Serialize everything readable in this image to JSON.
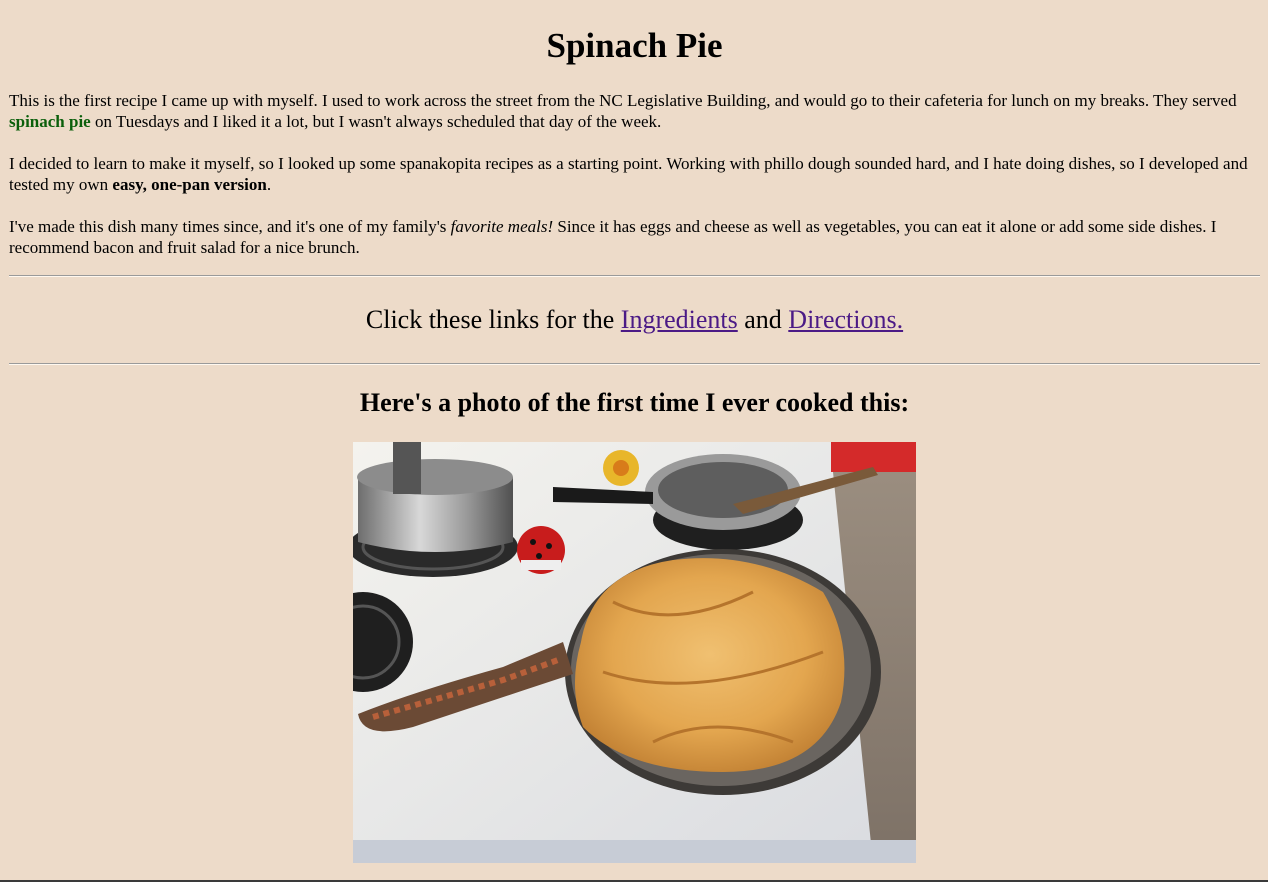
{
  "page": {
    "title": "Spinach Pie",
    "intro": {
      "p1_before": "This is the first recipe I came up with myself. I used to work across the street from the NC Legislative Building, and would go to their cafeteria for lunch on my breaks. They served ",
      "p1_emphasis": "spinach pie",
      "p1_after": " on Tuesdays and I liked it a lot, but I wasn't always scheduled that day of the week.",
      "p2_before": "I decided to learn to make it myself, so I looked up some spanakopita recipes as a starting point. Working with phillo dough sounded hard, and I hate doing dishes, so I developed and tested my own ",
      "p2_bold": "easy, one-pan version",
      "p2_after": ".",
      "p3_before": "I've made this dish many times since, and it's one of my family's ",
      "p3_italic": "favorite meals!",
      "p3_after": " Since it has eggs and cheese as well as vegetables, you can eat it alone or add some side dishes. I recommend bacon and fruit salad for a nice brunch."
    },
    "links": {
      "prefix": "Click these links for the ",
      "ingredients": "Ingredients",
      "middle": " and ",
      "directions": "Directions."
    },
    "photo_heading": "Here's a photo of the first time I ever cooked this:"
  },
  "colors": {
    "background": "#eddbc9",
    "emphasis_green": "#0b5f0b",
    "link_visited": "#4b1a86"
  }
}
